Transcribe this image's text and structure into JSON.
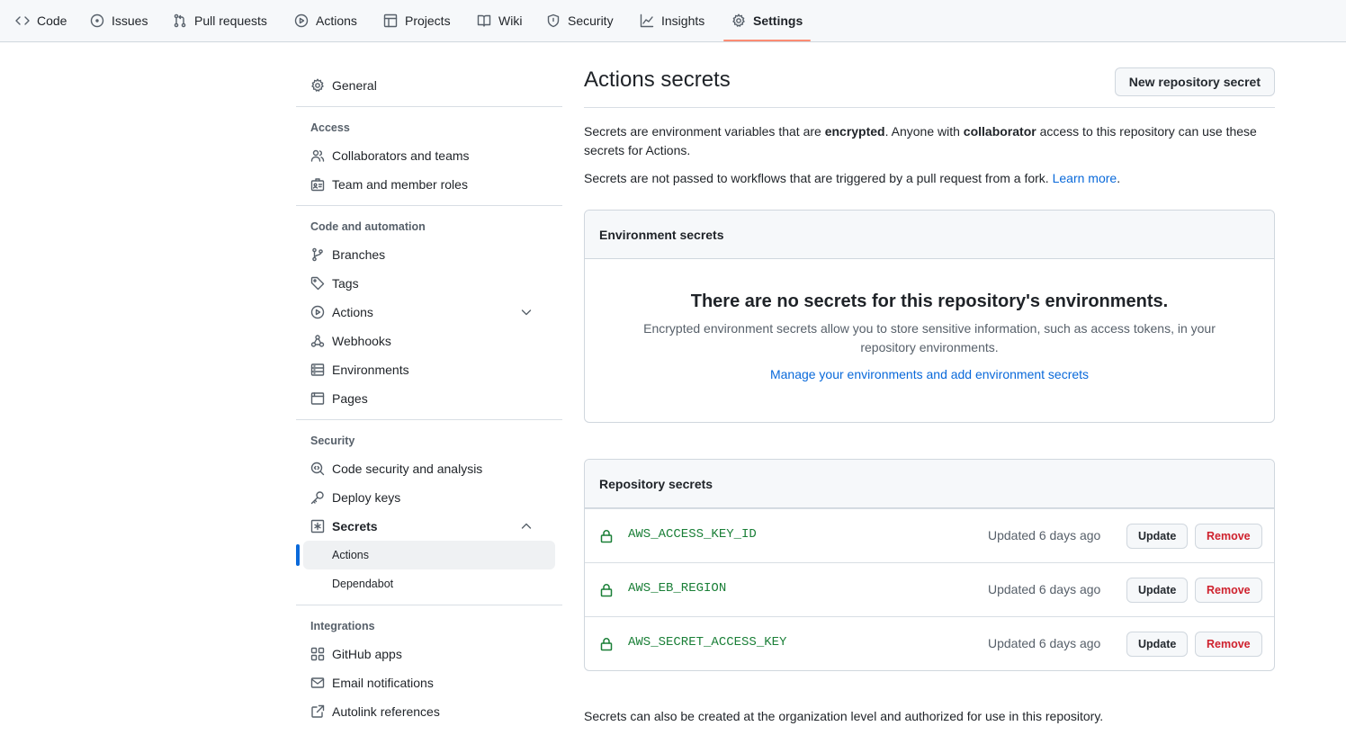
{
  "nav": {
    "tabs": [
      {
        "label": "Code",
        "icon": "code-icon"
      },
      {
        "label": "Issues",
        "icon": "issue-icon"
      },
      {
        "label": "Pull requests",
        "icon": "pull-request-icon"
      },
      {
        "label": "Actions",
        "icon": "play-icon"
      },
      {
        "label": "Projects",
        "icon": "table-icon"
      },
      {
        "label": "Wiki",
        "icon": "book-icon"
      },
      {
        "label": "Security",
        "icon": "shield-icon"
      },
      {
        "label": "Insights",
        "icon": "graph-icon"
      },
      {
        "label": "Settings",
        "icon": "gear-icon"
      }
    ],
    "active_tab": "Settings"
  },
  "sidebar": {
    "general": "General",
    "sections": [
      {
        "heading": "Access",
        "items": [
          "Collaborators and teams",
          "Team and member roles"
        ]
      },
      {
        "heading": "Code and automation",
        "items": [
          "Branches",
          "Tags",
          "Actions",
          "Webhooks",
          "Environments",
          "Pages"
        ]
      },
      {
        "heading": "Security",
        "items": [
          "Code security and analysis",
          "Deploy keys",
          "Secrets"
        ],
        "subitems": [
          "Actions",
          "Dependabot"
        ]
      },
      {
        "heading": "Integrations",
        "items": [
          "GitHub apps",
          "Email notifications",
          "Autolink references"
        ]
      }
    ],
    "active_subitem": "Actions"
  },
  "main": {
    "title": "Actions secrets",
    "new_secret_button": "New repository secret",
    "desc1_pre": "Secrets are environment variables that are ",
    "desc1_b1": "encrypted",
    "desc1_mid": ". Anyone with ",
    "desc1_b2": "collaborator",
    "desc1_post": " access to this repository can use these secrets for Actions.",
    "desc2_pre": "Secrets are not passed to workflows that are triggered by a pull request from a fork. ",
    "desc2_link": "Learn more",
    "desc2_post": ".",
    "environment": {
      "heading": "Environment secrets",
      "blank_title": "There are no secrets for this repository's environments.",
      "blank_desc": "Encrypted environment secrets allow you to store sensitive information, such as access tokens, in your repository environments.",
      "blank_link": "Manage your environments and add environment secrets"
    },
    "repository": {
      "heading": "Repository secrets",
      "update_label": "Update",
      "remove_label": "Remove",
      "secrets": [
        {
          "name": "AWS_ACCESS_KEY_ID",
          "updated": "Updated 6 days ago"
        },
        {
          "name": "AWS_EB_REGION",
          "updated": "Updated 6 days ago"
        },
        {
          "name": "AWS_SECRET_ACCESS_KEY",
          "updated": "Updated 6 days ago"
        }
      ]
    },
    "footer_note": "Secrets can also be created at the organization level and authorized for use in this repository."
  },
  "colors": {
    "accent": "#0969da",
    "tab_underline": "#fd8c73",
    "secret_green": "#1a7f37",
    "danger": "#cf222e"
  }
}
